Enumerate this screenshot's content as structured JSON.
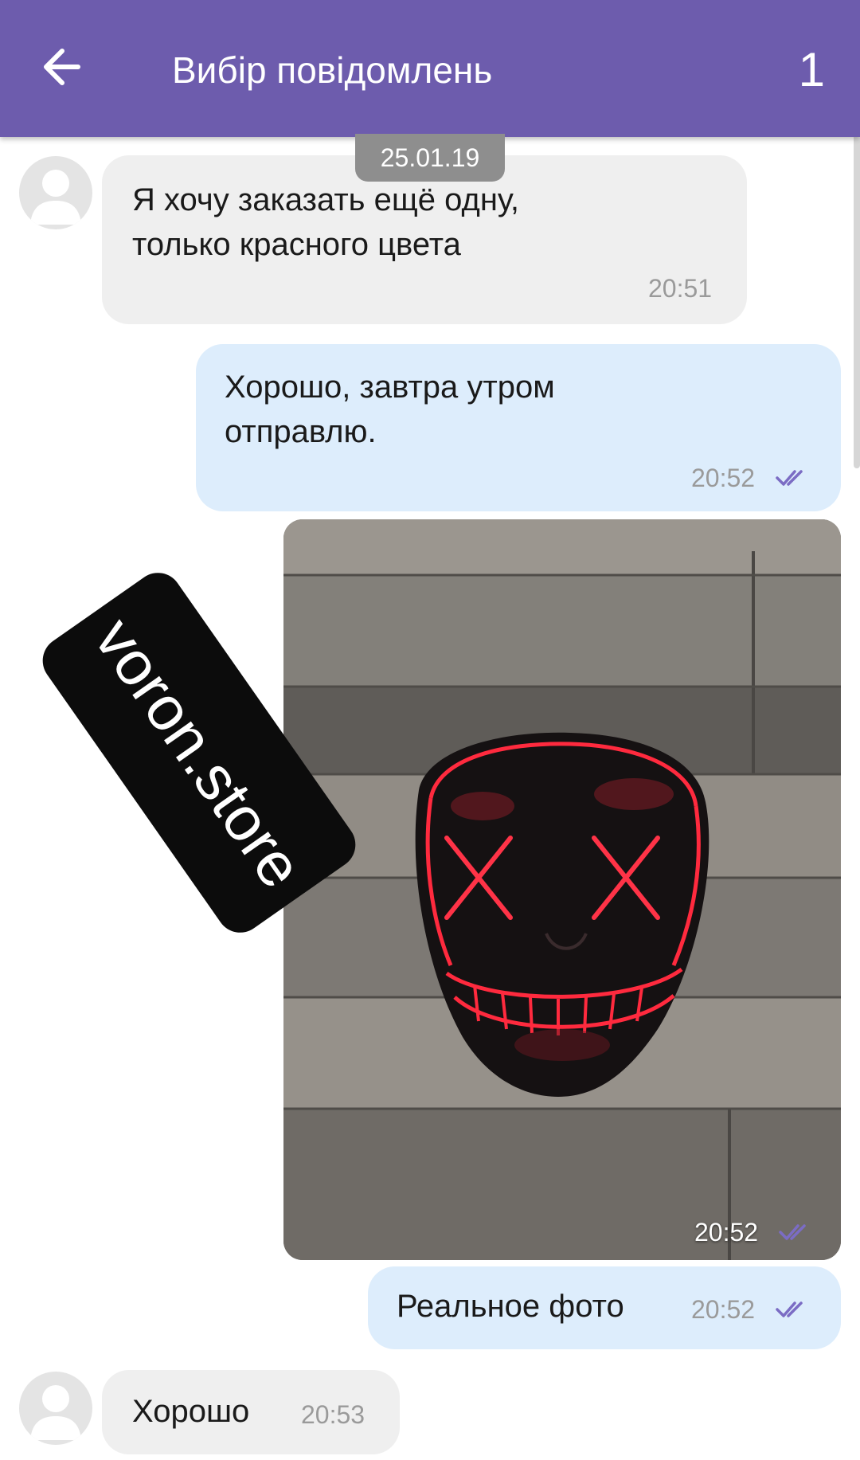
{
  "theme": {
    "accent": "#6d5cad",
    "incoming": "#efefef",
    "outgoing": "#ddedfc",
    "read_check": "#7b6cc4"
  },
  "header": {
    "back_icon": "arrow-left-icon",
    "title": "Вибір повідомлень",
    "selected_count": "1"
  },
  "date_divider": "25.01.19",
  "messages": [
    {
      "direction": "in",
      "text": "Я хочу заказать ещё одну,\nтолько красного цвета",
      "time": "20:51"
    },
    {
      "direction": "out",
      "text": "Хорошо, завтра утром\nотправлю.",
      "time": "20:52",
      "status_icon": "double-check-icon"
    },
    {
      "direction": "out",
      "type": "photo",
      "time": "20:52",
      "status_icon": "double-check-icon"
    },
    {
      "direction": "out",
      "text": "Реальное фото",
      "time": "20:52",
      "status_icon": "double-check-icon"
    },
    {
      "direction": "in",
      "text": "Хорошо",
      "time": "20:53"
    }
  ],
  "watermark": "voron.store"
}
